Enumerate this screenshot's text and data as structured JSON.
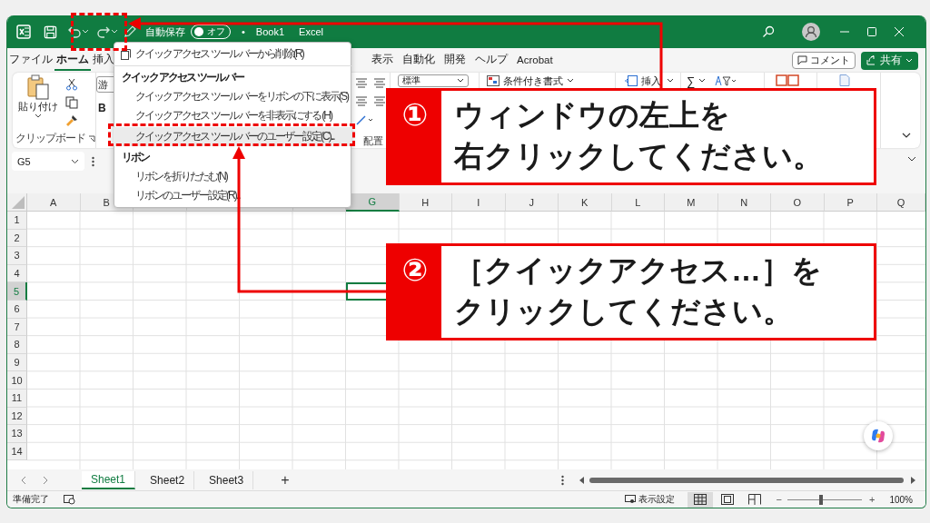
{
  "title_bar": {
    "autosave_label": "自動保存",
    "autosave_toggle": {
      "label": "オフ",
      "on": false
    },
    "separator": "•",
    "file_name": "Book1",
    "app_name": "Excel"
  },
  "ribbon_tabs_left": [
    {
      "label": "ファイル",
      "selected": false
    },
    {
      "label": "ホーム",
      "selected": true
    },
    {
      "label": "挿入",
      "selected": false
    }
  ],
  "ribbon_tabs_right": [
    {
      "label": "表示",
      "selected": false
    },
    {
      "label": "自動化",
      "selected": false
    },
    {
      "label": "開発",
      "selected": false
    },
    {
      "label": "ヘルプ",
      "selected": false
    },
    {
      "label": "Acrobat",
      "selected": false
    }
  ],
  "comment_button": "コメント",
  "share_button": "共有",
  "ribbon": {
    "paste_label": "貼り付け",
    "clipboard_label": "クリップボード",
    "font_box": "游",
    "bold_label": "B",
    "alignment_label": "配置",
    "number_format": "標準",
    "conditional_format": "条件付き書式",
    "insert_label": "挿入",
    "sum_symbol": "∑"
  },
  "formula_bar": {
    "name_box": "G5"
  },
  "context_menu": [
    {
      "kind": "command",
      "label": "クイック アクセス ツール バーから削除(R)",
      "has_icon": true,
      "selected": false
    },
    {
      "kind": "divider"
    },
    {
      "kind": "header",
      "label": "クイック アクセス ツール バー"
    },
    {
      "kind": "command",
      "label": "クイック アクセス ツール バーをリボンの下に表示(S)",
      "has_icon": false,
      "selected": false
    },
    {
      "kind": "command",
      "label": "クイック アクセス ツール バーを非表示にする (H)",
      "has_icon": false,
      "selected": false
    },
    {
      "kind": "command",
      "label": "クイック アクセス ツール バーのユーザー設定(C)...",
      "has_icon": false,
      "selected": true
    },
    {
      "kind": "header",
      "label": "リボン"
    },
    {
      "kind": "command",
      "label": "リボンを折りたたむ(N)",
      "has_icon": false,
      "selected": false
    },
    {
      "kind": "command",
      "label": "リボンのユーザー設定(R)...",
      "has_icon": false,
      "selected": false
    }
  ],
  "columns_left": [
    {
      "label": "A",
      "selected": false
    },
    {
      "label": "B",
      "selected": false
    }
  ],
  "columns_right": [
    {
      "label": "G",
      "selected": true
    },
    {
      "label": "H",
      "selected": false
    },
    {
      "label": "I",
      "selected": false
    },
    {
      "label": "J",
      "selected": false
    },
    {
      "label": "K",
      "selected": false
    },
    {
      "label": "L",
      "selected": false
    },
    {
      "label": "M",
      "selected": false
    },
    {
      "label": "N",
      "selected": false
    },
    {
      "label": "O",
      "selected": false
    },
    {
      "label": "P",
      "selected": false
    },
    {
      "label": "Q",
      "selected": false
    }
  ],
  "rows": [
    {
      "label": "1",
      "selected": false
    },
    {
      "label": "2",
      "selected": false
    },
    {
      "label": "3",
      "selected": false
    },
    {
      "label": "4",
      "selected": false
    },
    {
      "label": "5",
      "selected": true
    },
    {
      "label": "6",
      "selected": false
    },
    {
      "label": "7",
      "selected": false
    },
    {
      "label": "8",
      "selected": false
    },
    {
      "label": "9",
      "selected": false
    },
    {
      "label": "10",
      "selected": false
    },
    {
      "label": "11",
      "selected": false
    },
    {
      "label": "12",
      "selected": false
    },
    {
      "label": "13",
      "selected": false
    },
    {
      "label": "14",
      "selected": false
    }
  ],
  "sheet_tabs": [
    {
      "label": "Sheet1",
      "selected": true
    },
    {
      "label": "Sheet2",
      "selected": false
    },
    {
      "label": "Sheet3",
      "selected": false
    }
  ],
  "add_sheet": "+",
  "status_bar": {
    "status": "準備完了",
    "display_settings": "表示設定",
    "view_buttons": [
      {
        "kind": "normal",
        "selected": true
      },
      {
        "kind": "page_layout",
        "selected": false
      },
      {
        "kind": "page_break",
        "selected": false
      }
    ],
    "zoom_minus": "−",
    "zoom_plus": "+",
    "zoom_slider": {
      "level": 0.45
    },
    "zoom": "100%"
  },
  "callouts": [
    {
      "number": "①",
      "lines": [
        "ウィンドウの左上を",
        "右クリックしてください。"
      ]
    },
    {
      "number": "②",
      "lines": [
        "［クイックアクセス…］を",
        "クリックしてください。"
      ]
    }
  ]
}
